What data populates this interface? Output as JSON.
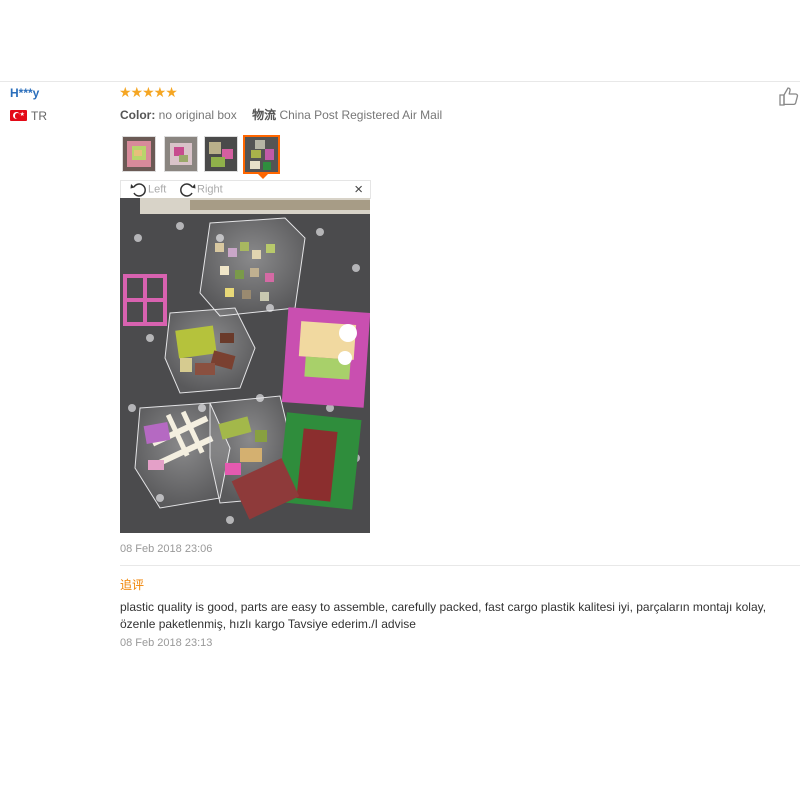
{
  "reviewer": {
    "name": "H***y",
    "country_code": "TR",
    "flag_icon": "turkey-flag-icon"
  },
  "review": {
    "rating": 5,
    "stars_text": "★★★★★",
    "star_color": "#f5a623",
    "color_label": "Color:",
    "color_value": "no original box",
    "shipping_label": "物流",
    "shipping_value": "China Post Registered Air Mail",
    "photos_count": 4,
    "active_photo_index": 3,
    "viewer": {
      "rotate_left_label": "Left",
      "rotate_right_label": "Right",
      "close_label": "×"
    },
    "date": "08 Feb 2018 23:06"
  },
  "followup": {
    "label": "追评",
    "label_color": "#f08200",
    "text": "plastic quality is good, parts are easy to assemble, carefully packed, fast cargo plastik kalitesi iyi, parçaların montajı kolay, özenle paketlenmiş, hızlı kargo Tavsiye ederim./I advise",
    "date": "08 Feb 2018 23:13"
  },
  "icons": {
    "helpful": "thumbs-up-icon",
    "rotate_left": "rotate-left-icon",
    "rotate_right": "rotate-right-icon",
    "close": "close-icon"
  },
  "colors": {
    "accent_active": "#ff6600",
    "username": "#2a6ebb"
  }
}
